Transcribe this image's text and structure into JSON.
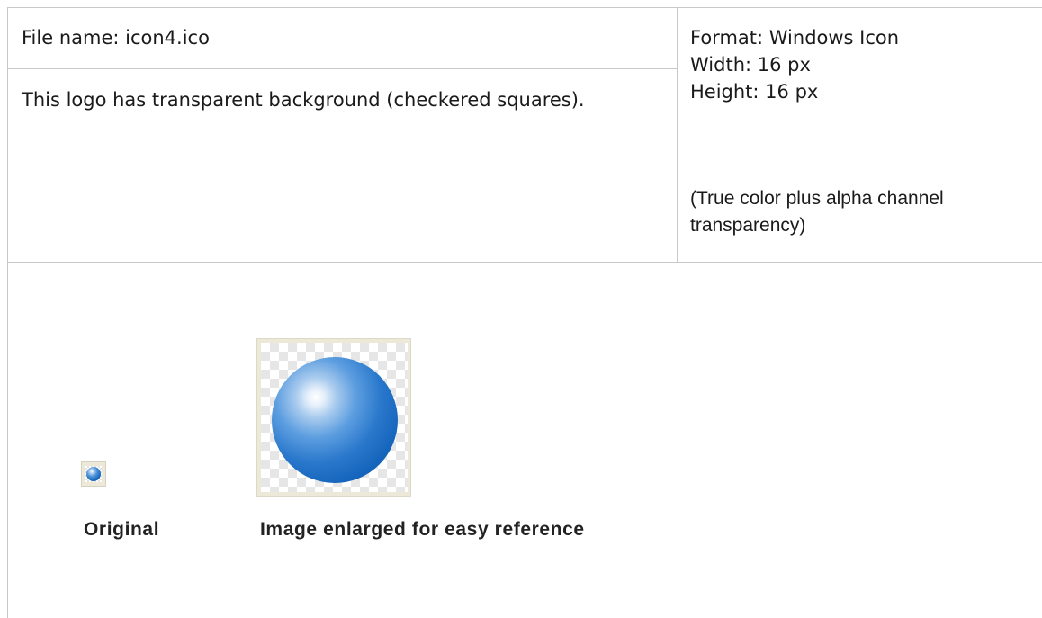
{
  "file_name": "File name: icon4.ico",
  "description": "This logo has transparent background (checkered squares).",
  "format": "Format: Windows Icon",
  "width": "Width: 16 px",
  "height": "Height: 16 px",
  "note": "(True color plus alpha channel transparency)",
  "original_caption": "Original",
  "enlarged_caption": "Image enlarged for easy reference",
  "colors": {
    "border": "#c8c8c8",
    "frame": "#ece9d8",
    "ball": "#1565bd"
  }
}
